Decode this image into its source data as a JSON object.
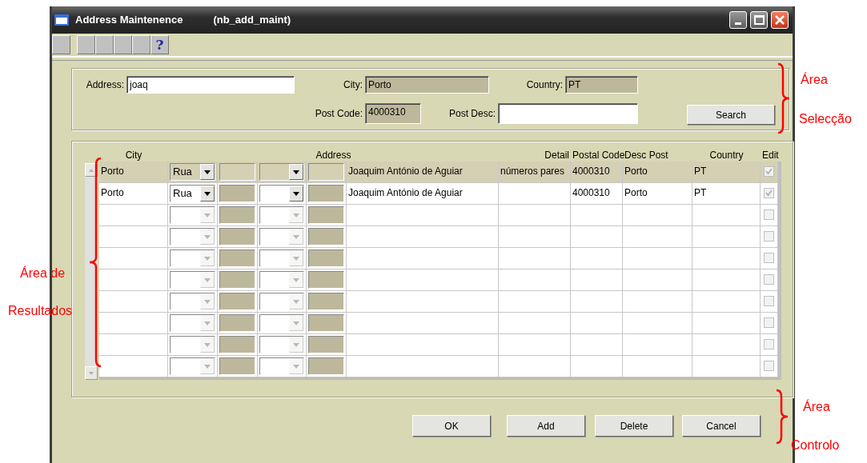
{
  "window": {
    "title": "Address Maintenence",
    "subtitle": "(nb_add_maint)"
  },
  "toolbar": {
    "help_label": "?"
  },
  "selection": {
    "address_label": "Address:",
    "address_value": "joaq",
    "city_label": "City:",
    "city_value": "Porto",
    "country_label": "Country:",
    "country_value": "PT",
    "post_code_label": "Post Code:",
    "post_code_value": "4000310",
    "post_desc_label": "Post Desc:",
    "search_button": "Search"
  },
  "table": {
    "columns": [
      "City",
      "Address",
      "Detail",
      "Postal Code",
      "Desc Post",
      "Country",
      "Edit"
    ],
    "rows": [
      {
        "selected": true,
        "enabled": true,
        "edit": true,
        "city": "Porto",
        "street_type": "Rua",
        "address": "Joaquim António de Aguiar",
        "detail": "números pares",
        "postal_code": "4000310",
        "desc_post": "Porto",
        "country": "PT"
      },
      {
        "selected": false,
        "enabled": true,
        "edit": true,
        "city": "Porto",
        "street_type": "Rua",
        "address": "Joaquim António de Aguiar",
        "postal_code": "4000310",
        "desc_post": "Porto",
        "country": "PT"
      },
      {
        "selected": false,
        "enabled": false,
        "edit": false
      },
      {
        "selected": false,
        "enabled": false,
        "edit": false
      },
      {
        "selected": false,
        "enabled": false,
        "edit": false
      },
      {
        "selected": false,
        "enabled": false,
        "edit": false
      },
      {
        "selected": false,
        "enabled": false,
        "edit": false
      },
      {
        "selected": false,
        "enabled": false,
        "edit": false
      },
      {
        "selected": false,
        "enabled": false,
        "edit": false
      },
      {
        "selected": false,
        "enabled": false,
        "edit": false
      }
    ]
  },
  "buttons": [
    "OK",
    "Add",
    "Delete",
    "Cancel"
  ],
  "annotations": [
    {
      "lines": [
        "Área",
        "Selecção"
      ]
    },
    {
      "lines": [
        "Área de",
        "Resultados"
      ]
    },
    {
      "lines": [
        "Área",
        "Controlo"
      ]
    }
  ]
}
